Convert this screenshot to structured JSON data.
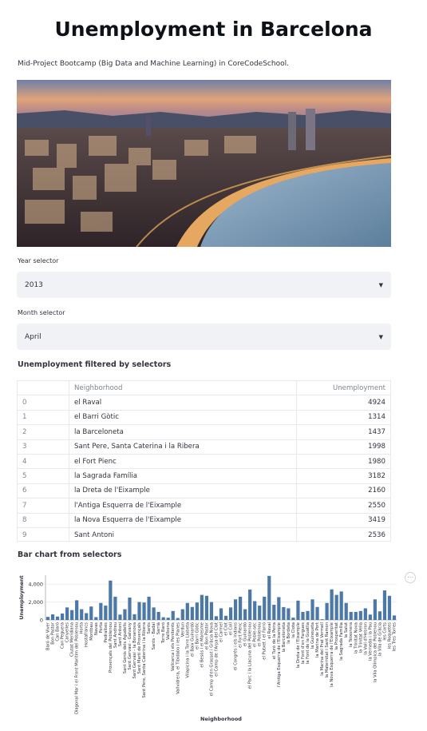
{
  "header": {
    "title": "Unemployment in Barcelona",
    "subtitle": "Mid-Project Bootcamp (Big Data and Machine Learning) in CoreCodeSchool."
  },
  "year_selector": {
    "label": "Year selector",
    "value": "2013"
  },
  "month_selector": {
    "label": "Month selector",
    "value": "April"
  },
  "table_section": {
    "title": "Unemployment filtered by selectors",
    "columns": [
      "",
      "Neighborhood",
      "Unemployment"
    ],
    "rows": [
      {
        "idx": "0",
        "name": "el Raval",
        "value": "4924"
      },
      {
        "idx": "1",
        "name": "el Barri Gòtic",
        "value": "1314"
      },
      {
        "idx": "2",
        "name": "la Barceloneta",
        "value": "1437"
      },
      {
        "idx": "3",
        "name": "Sant Pere, Santa Caterina i la Ribera",
        "value": "1998"
      },
      {
        "idx": "4",
        "name": "el Fort Pienc",
        "value": "1980"
      },
      {
        "idx": "5",
        "name": "la Sagrada Família",
        "value": "3182"
      },
      {
        "idx": "6",
        "name": "la Dreta de l'Eixample",
        "value": "2160"
      },
      {
        "idx": "7",
        "name": "l'Antiga Esquerra de l'Eixample",
        "value": "2550"
      },
      {
        "idx": "8",
        "name": "la Nova Esquerra de l'Eixample",
        "value": "3419"
      },
      {
        "idx": "9",
        "name": "Sant Antoni",
        "value": "2536"
      }
    ]
  },
  "chart_section": {
    "title": "Bar chart from selectors",
    "menu_icon": "more-horizontal-icon"
  },
  "colors": {
    "bar": "#4c78a8",
    "select_bg": "#f0f2f6"
  },
  "chart_data": {
    "type": "bar",
    "xlabel": "Neighborhood",
    "ylabel": "Unemployment",
    "yticks": [
      "0",
      "2,000",
      "4,000"
    ],
    "ylim": [
      0,
      5000
    ],
    "grid": true,
    "categories": [
      "Baró de Viver",
      "Bon Pastor",
      "Can Baró",
      "Can Peguera",
      "Canyelles",
      "Ciutat Meridiana",
      "Diagonal Mar i el Front Marítim del Poblenou",
      "Horta",
      "Hostafrancs",
      "Montbau",
      "Navas",
      "Porta",
      "Pedralbes",
      "Provençals del Poblenou",
      "Sant Andreu",
      "Sant Antoni",
      "Sant Genís dels Agudells",
      "Sant Gervasi - Galvany",
      "Sant Gervasi - la Bonanova",
      "Sant Martí de Provençals",
      "Sant Pere, Santa Caterina i la Ribera",
      "Sants",
      "Sants - Badal",
      "Sarrià",
      "Torre Baró",
      "Vallbona",
      "Vallcarca i els Penitents",
      "Vallvidrera, el Tibidabo i les Planes",
      "Verdun",
      "Vilapicina i la Torre Llobeta",
      "el Baix Guinardó",
      "el Barri Gòtic",
      "el Besòs i el Maresme",
      "el Bon Pastor",
      "el Camp d'en Grassot i Gràcia Nova",
      "el Camp de l'Arpa del Clot",
      "el Carmel",
      "el Clot",
      "el Coll",
      "el Congrés i els Indians",
      "el Fort Pienc",
      "el Guinardó",
      "el Parc i la Llacuna del Poblenou",
      "el Poble-sec",
      "el Poblenou",
      "el Putxet i el Farró",
      "el Raval",
      "el Turó de la Peira",
      "l'Antiga Esquerra de l'Eixample",
      "la Barceloneta",
      "la Bordeta",
      "la Clota",
      "la Dreta de l'Eixample",
      "la Font d'en Fargues",
      "la Font de la Guatlla",
      "la Guineueta",
      "la Marina de Port",
      "la Marina del Prat Vermell",
      "la Maternitat i Sant Ramon",
      "la Nova Esquerra de l'Eixample",
      "la Prosperitat",
      "la Sagrada Família",
      "la Salut",
      "la Teixonera",
      "la Trinitat Nova",
      "la Trinitat Vella",
      "la Vall d'Hebron",
      "la Verneda i la Pau",
      "la Vila Olímpica del Poblenou",
      "la Vila de Gràcia",
      "les Corts",
      "les Roquetes",
      "les Tres Torres"
    ],
    "values": [
      340,
      620,
      380,
      720,
      1400,
      1100,
      2200,
      1200,
      760,
      1500,
      320,
      1900,
      1600,
      4400,
      2600,
      600,
      1200,
      2500,
      640,
      2000,
      1950,
      2600,
      1400,
      900,
      300,
      250,
      1000,
      220,
      1200,
      1900,
      1450,
      1950,
      2800,
      2700,
      2000,
      420,
      1300,
      460,
      1400,
      2300,
      2600,
      1200,
      3400,
      2100,
      1600,
      2600,
      4924,
      1700,
      2550,
      1437,
      1300,
      260,
      2160,
      900,
      1000,
      2300,
      1450,
      80,
      1900,
      3419,
      2800,
      3182,
      1900,
      900,
      900,
      1000,
      1300,
      600,
      2300,
      960,
      3300,
      2700,
      500
    ]
  }
}
